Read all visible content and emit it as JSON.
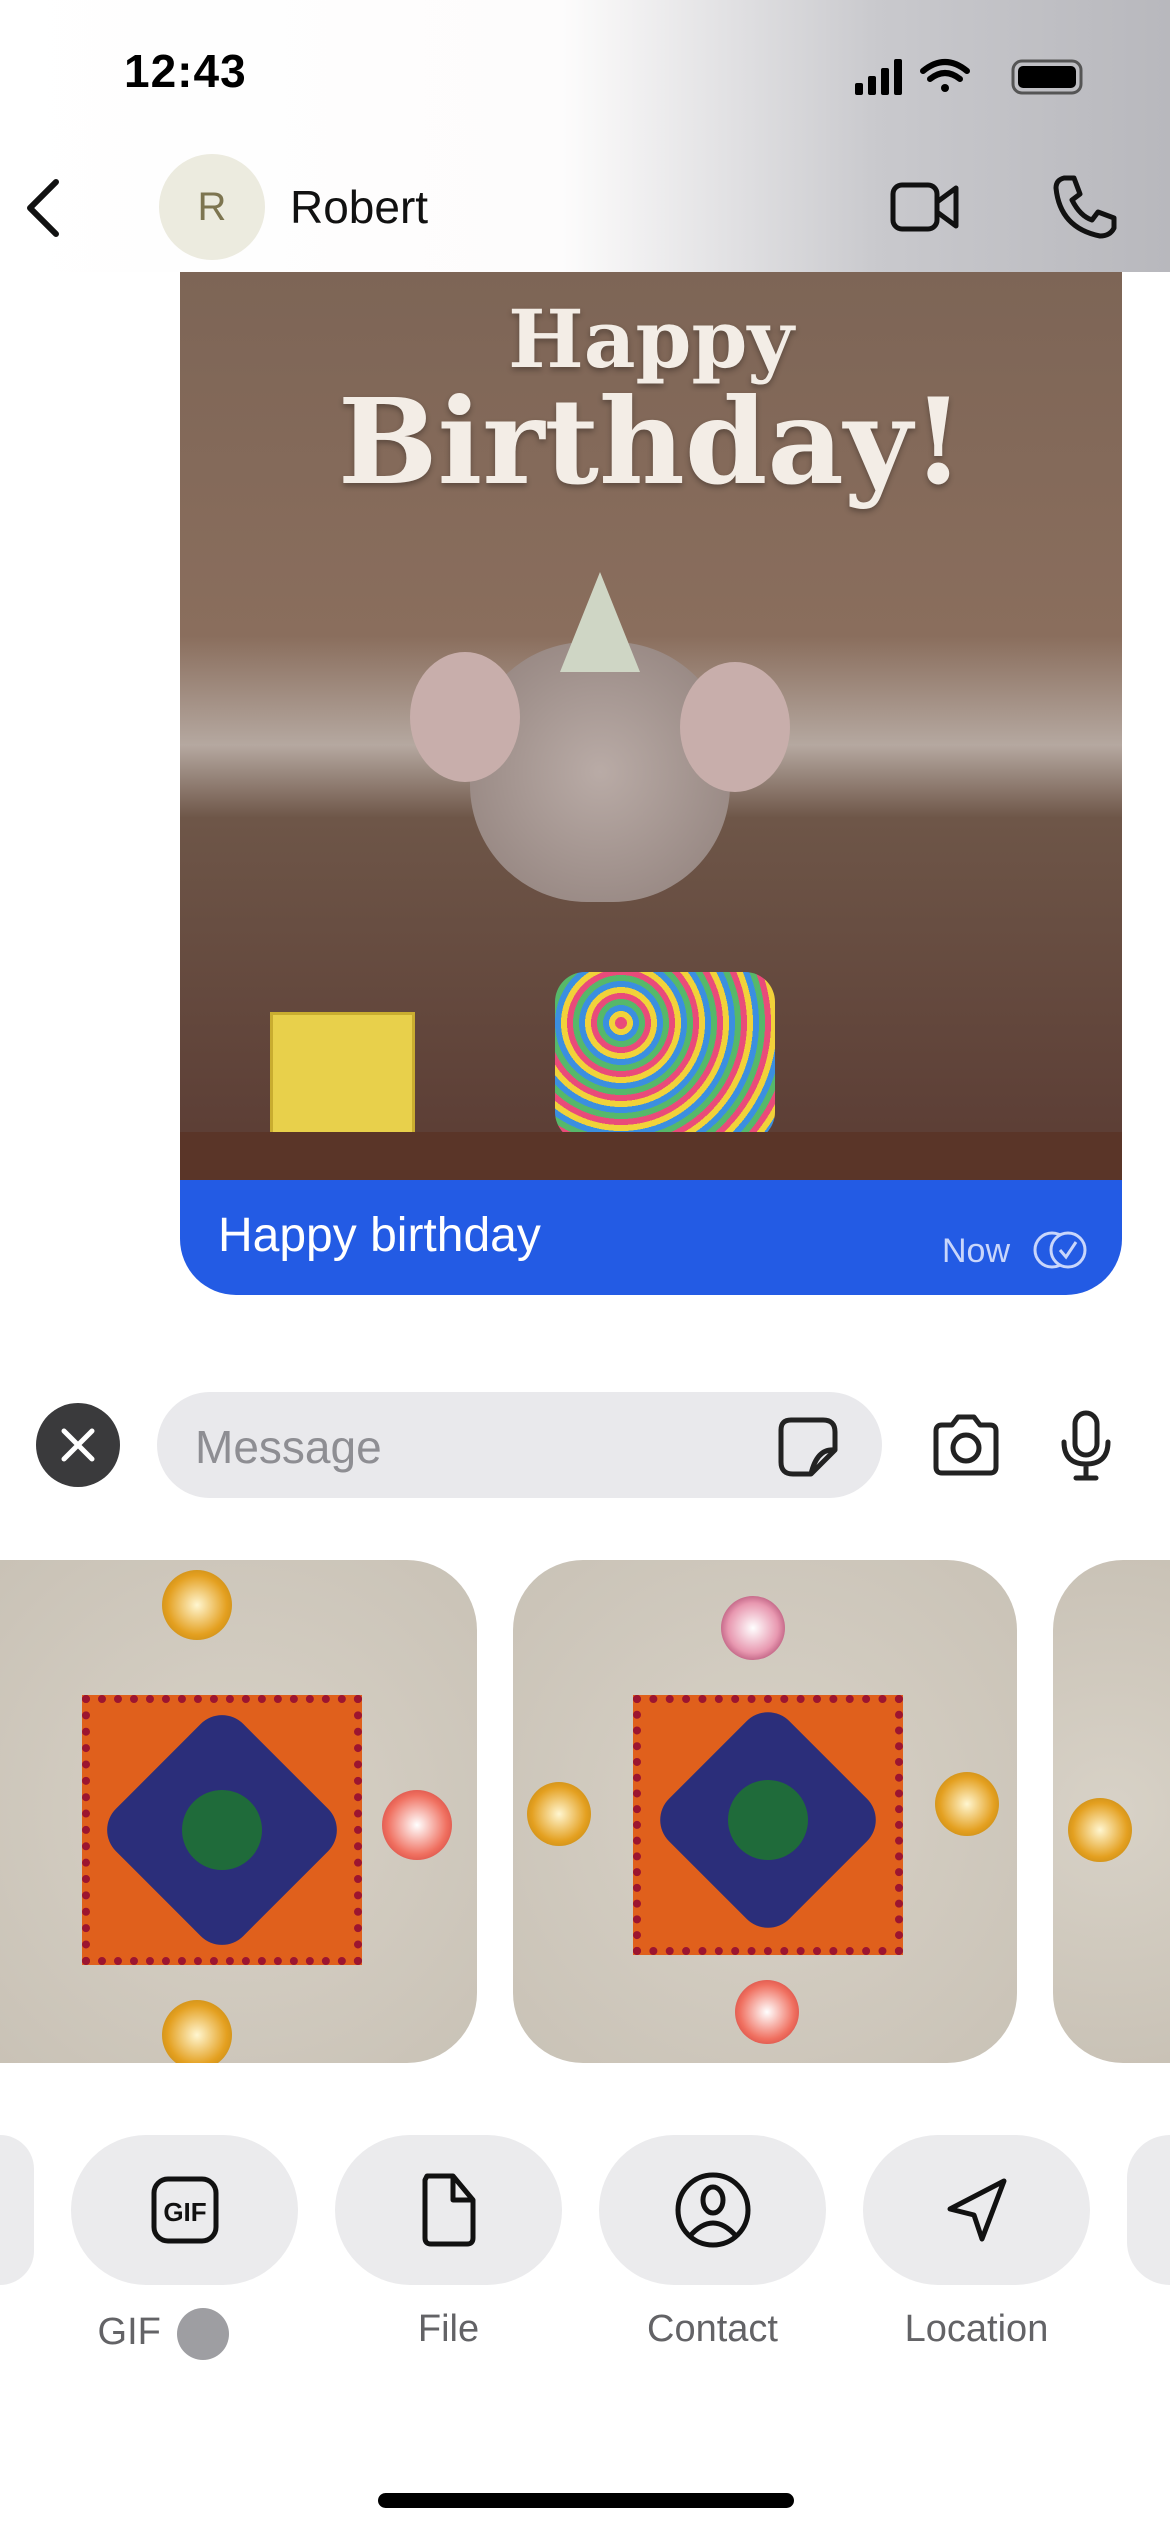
{
  "status_bar": {
    "time": "12:43"
  },
  "header": {
    "contact_name": "Robert",
    "avatar_initial": "R"
  },
  "message": {
    "gif_caption_line1": "Happy",
    "gif_caption_line2": "Birthday!",
    "text": "Happy birthday",
    "time": "Now",
    "bubble_color": "#235be4"
  },
  "composer": {
    "placeholder": "Message"
  },
  "attachments": [
    {
      "label": "GIF"
    },
    {
      "label": "File"
    },
    {
      "label": "Contact"
    },
    {
      "label": "Location"
    }
  ]
}
